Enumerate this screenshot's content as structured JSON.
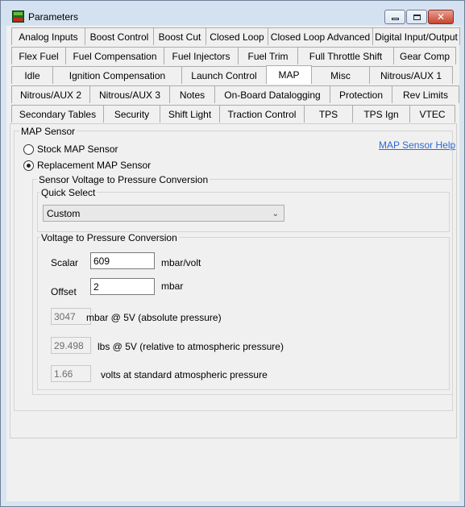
{
  "window": {
    "title": "Parameters"
  },
  "tabs": {
    "row1": [
      "Analog Inputs",
      "Boost Control",
      "Boost Cut",
      "Closed Loop",
      "Closed Loop Advanced",
      "Digital Input/Output"
    ],
    "row2": [
      "Flex Fuel",
      "Fuel Compensation",
      "Fuel Injectors",
      "Fuel Trim",
      "Full Throttle Shift",
      "Gear Comp"
    ],
    "row3": [
      "Idle",
      "Ignition Compensation",
      "Launch Control",
      "MAP",
      "Misc",
      "Nitrous/AUX 1"
    ],
    "row4": [
      "Nitrous/AUX 2",
      "Nitrous/AUX 3",
      "Notes",
      "On-Board Datalogging",
      "Protection",
      "Rev Limits"
    ],
    "row5": [
      "Secondary Tables",
      "Security",
      "Shift Light",
      "Traction Control",
      "TPS",
      "TPS Ign",
      "VTEC"
    ],
    "active": "MAP"
  },
  "map_sensor": {
    "group_label": "MAP Sensor",
    "help_link": "MAP Sensor Help",
    "stock_label": "Stock MAP Sensor",
    "replacement_label": "Replacement MAP Sensor",
    "selected": "replacement"
  },
  "conversion": {
    "group_label": "Sensor Voltage to Pressure Conversion",
    "quick_select": {
      "label": "Quick Select",
      "value": "Custom"
    },
    "vtp": {
      "label": "Voltage to Pressure Conversion",
      "scalar_label": "Scalar",
      "scalar_value": "609",
      "scalar_unit": "mbar/volt",
      "offset_label": "Offset",
      "offset_value": "2",
      "offset_unit": "mbar",
      "abs_value": "3047",
      "abs_unit": "mbar @ 5V (absolute pressure)",
      "rel_value": "29.498",
      "rel_unit": "lbs @ 5V (relative to atmospheric pressure)",
      "volts_value": "1.66",
      "volts_unit": "volts at standard atmospheric pressure"
    }
  }
}
